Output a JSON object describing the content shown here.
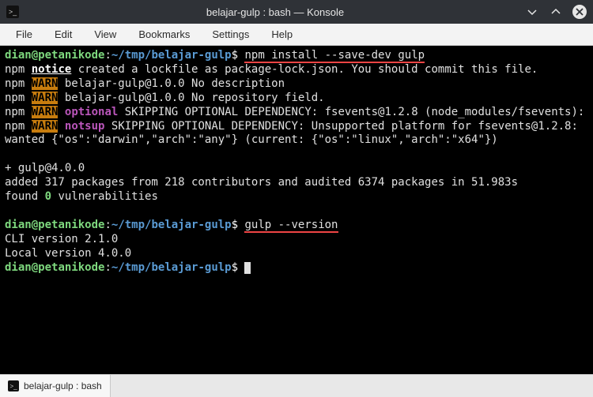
{
  "titlebar": {
    "app_icon": ">_",
    "title": "belajar-gulp : bash — Konsole"
  },
  "menubar": {
    "items": [
      "File",
      "Edit",
      "View",
      "Bookmarks",
      "Settings",
      "Help"
    ]
  },
  "prompt": {
    "user": "dian",
    "at": "@",
    "host": "petanikode",
    "colon": ":",
    "path": "~/tmp/belajar-gulp",
    "symbol": "$"
  },
  "commands": {
    "cmd1": "npm install --save-dev gulp",
    "cmd2": "gulp --version"
  },
  "npm": {
    "label": "npm",
    "warn": "WARN",
    "notice": "notice",
    "optional": "optional",
    "notsup": "notsup"
  },
  "output": {
    "lockfile": " created a lockfile as package-lock.json. You should commit this file.",
    "nodesc": " belajar-gulp@1.0.0 No description",
    "norepo": " belajar-gulp@1.0.0 No repository field.",
    "skip1": " SKIPPING OPTIONAL DEPENDENCY: fsevents@1.2.8 (node_modules/fsevents):",
    "skip2": " SKIPPING OPTIONAL DEPENDENCY: Unsupported platform for fsevents@1.2.8: wanted {\"os\":\"darwin\",\"arch\":\"any\"} (current: {\"os\":\"linux\",\"arch\":\"x64\"})",
    "plusline": "+ gulp@4.0.0",
    "added": "added 317 packages from 218 contributors and audited 6374 packages in 51.983s",
    "found_a": "found ",
    "found_n": "0",
    "found_b": " vulnerabilities",
    "cli": "CLI version 2.1.0",
    "local": "Local version 4.0.0"
  },
  "tab": {
    "icon": ">_",
    "label": "belajar-gulp : bash"
  }
}
